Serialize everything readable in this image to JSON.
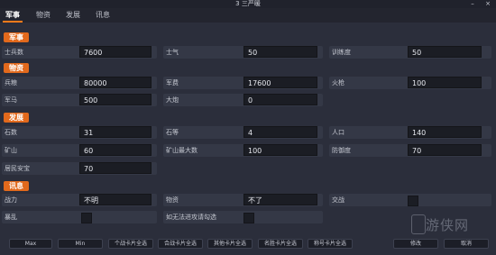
{
  "window": {
    "title": "3 三严暖",
    "minimize": "–",
    "close": "×"
  },
  "tabs": [
    "军事",
    "物资",
    "发展",
    "讯息"
  ],
  "sections": {
    "military": "军事",
    "supplies": "物资",
    "development": "发展",
    "info": "讯息"
  },
  "military": [
    {
      "label": "士兵数",
      "value": "7600"
    },
    {
      "label": "士气",
      "value": "50"
    },
    {
      "label": "训练度",
      "value": "50"
    }
  ],
  "supplies": [
    {
      "label": "兵粮",
      "value": "80000"
    },
    {
      "label": "军费",
      "value": "17600"
    },
    {
      "label": "火枪",
      "value": "100"
    },
    {
      "label": "军马",
      "value": "500"
    },
    {
      "label": "大炮",
      "value": "0"
    }
  ],
  "development": [
    {
      "label": "石数",
      "value": "31"
    },
    {
      "label": "石等",
      "value": "4"
    },
    {
      "label": "人口",
      "value": "140"
    },
    {
      "label": "矿山",
      "value": "60"
    },
    {
      "label": "矿山最大数",
      "value": "100"
    },
    {
      "label": "防御度",
      "value": "70"
    },
    {
      "label": "居民安宝",
      "value": "70"
    }
  ],
  "info": [
    {
      "label": "战力",
      "value": "不明"
    },
    {
      "label": "物资",
      "value": "不了"
    },
    {
      "label": "交战"
    },
    {
      "label": "暴乱"
    },
    {
      "label": "如无法进攻请勾选"
    }
  ],
  "buttons": {
    "max": "Max",
    "min": "Min",
    "select_all_1": "个战卡片全选",
    "select_all_2": "合战卡片全选",
    "select_all_3": "其他卡片全选",
    "select_all_4": "名胜卡片全选",
    "select_all_5": "称号卡片全选",
    "modify": "修改",
    "cancel": "取消"
  },
  "watermark": "游侠网"
}
